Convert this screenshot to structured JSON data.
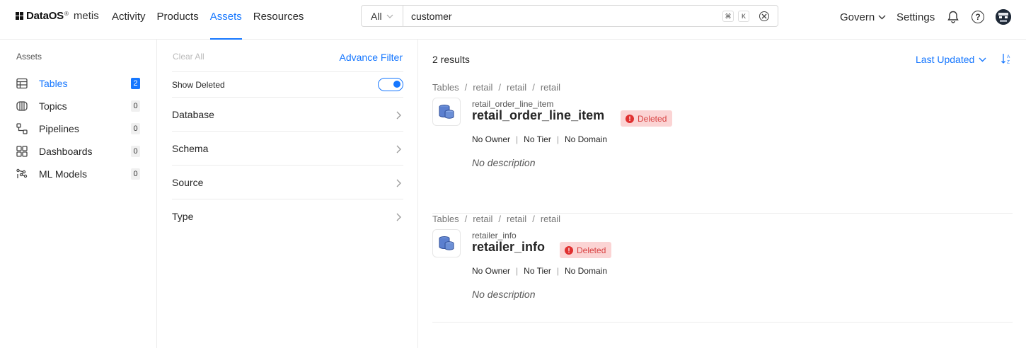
{
  "header": {
    "brand": "DataOS",
    "brand_mark": "®",
    "product": "metis",
    "nav": [
      {
        "label": "Activity",
        "active": false
      },
      {
        "label": "Products",
        "active": false
      },
      {
        "label": "Assets",
        "active": true
      },
      {
        "label": "Resources",
        "active": false
      }
    ],
    "search": {
      "scope": "All",
      "value": "customer",
      "kbd_cmd": "⌘",
      "kbd_key": "K"
    },
    "govern": "Govern",
    "settings": "Settings",
    "accent": "#1677ff"
  },
  "sidebar": {
    "heading": "Assets",
    "items": [
      {
        "label": "Tables",
        "count": "2",
        "icon": "table-icon",
        "active": true
      },
      {
        "label": "Topics",
        "count": "0",
        "icon": "topic-icon",
        "active": false
      },
      {
        "label": "Pipelines",
        "count": "0",
        "icon": "pipeline-icon",
        "active": false
      },
      {
        "label": "Dashboards",
        "count": "0",
        "icon": "dashboard-icon",
        "active": false
      },
      {
        "label": "ML Models",
        "count": "0",
        "icon": "ml-model-icon",
        "active": false
      }
    ]
  },
  "filters": {
    "clear_all": "Clear All",
    "advance_filter": "Advance Filter",
    "show_deleted": "Show Deleted",
    "show_deleted_on": true,
    "facets": [
      "Database",
      "Schema",
      "Source",
      "Type"
    ]
  },
  "results": {
    "count_label": "2 results",
    "sort_label": "Last Updated",
    "items": [
      {
        "breadcrumb": [
          "Tables",
          "retail",
          "retail",
          "retail"
        ],
        "fqn": "retail_order_line_item",
        "name": "retail_order_line_item",
        "badge": "Deleted",
        "owner": "No Owner",
        "tier": "No Tier",
        "domain": "No Domain",
        "description": "No description"
      },
      {
        "breadcrumb": [
          "Tables",
          "retail",
          "retail",
          "retail"
        ],
        "fqn": "retailer_info",
        "name": "retailer_info",
        "badge": "Deleted",
        "owner": "No Owner",
        "tier": "No Tier",
        "domain": "No Domain",
        "description": "No description"
      }
    ]
  }
}
